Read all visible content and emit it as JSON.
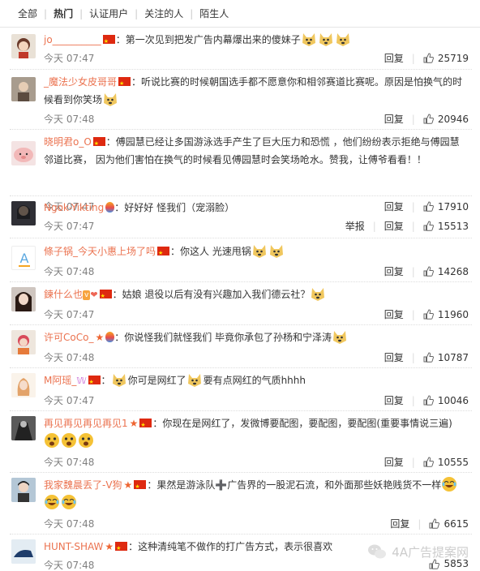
{
  "tabs": [
    "全部",
    "热门",
    "认证用户",
    "关注的人",
    "陌生人"
  ],
  "actions": {
    "report": "举报",
    "reply": "回复"
  },
  "comments": [
    {
      "user": "jo__________",
      "text": "：第一次见到把发广告内幕爆出来的傻妹子",
      "emojis": 3,
      "time": "今天 07:47",
      "likes": "25719",
      "report": false
    },
    {
      "user": "_魔法少女皮哥哥",
      "text": "：听说比赛的时候朝国选手都不愿意你和相邻赛道比赛呢。原因是怕换气的时候看到你笑场",
      "emojis": 1,
      "time": "今天 07:48",
      "likes": "20946",
      "report": false
    },
    {
      "user": "晓明君o_O",
      "text": "：傅园慧已经让多国游泳选手产生了巨大压力和恐慌 ，他们纷纷表示拒绝与傅园慧邻道比赛， 因为他们害怕在换气的时候看见傅园慧时会笑场呛水。赞我，让傅爷看看！！",
      "emojis": 0,
      "time": "今天 07:47",
      "likes": "17910",
      "report": false
    },
    {
      "user": "Ngok-Yikting",
      "text": "：好好好 怪我们（宠溺脸）",
      "emojis": 0,
      "time": "今天 07:47",
      "likes": "15513",
      "report": true
    },
    {
      "user": "條子锅_今天小惠上场了吗",
      "text": "：你这人 光速甩锅",
      "emojis": 2,
      "time": "今天 07:48",
      "likes": "14268",
      "report": false
    },
    {
      "user": "鍊什么也",
      "text": "：姑娘 退役以后有没有兴趣加入我们德云社？",
      "emojis": 1,
      "time": "今天 07:47",
      "likes": "11960",
      "report": false
    },
    {
      "user": "许可CoCo_",
      "text": "：你说怪我们就怪我们 毕竟你承包了孙杨和宁泽涛",
      "emojis": 1,
      "time": "今天 07:48",
      "likes": "10787",
      "report": false
    },
    {
      "user": "M阿瑶_",
      "text": "：",
      "text2": "你可是网红了",
      "text3": "要有点网红的气质hhhh",
      "emojis": 0,
      "time": "今天 07:47",
      "likes": "10046",
      "report": false
    },
    {
      "user": "再见再见再见再见1",
      "text": "：你现在是网红了，发微博要配图，要配图，要配图(重要事情说三遍)",
      "emojis": 3,
      "time": "今天 07:48",
      "likes": "10555",
      "report": false
    },
    {
      "user": "我家魏晨丢了-V狗",
      "text": "：果然是游泳队➕广告界的一股泥石流，和外面那些妖艳贱货不一样",
      "emojis": 2,
      "time": "今天 07:48",
      "likes": "6615",
      "report": false
    },
    {
      "user": "HUNT-SHAW",
      "text": "：这种清纯笔不做作的打广告方式，表示很喜欢",
      "emojis": 0,
      "time": "今天 07:48",
      "likes": "5853",
      "report": false
    }
  ],
  "watermark": "4A广告提案网",
  "colors": {
    "username": "#eb7350",
    "time": "#808080",
    "text": "#333333"
  }
}
